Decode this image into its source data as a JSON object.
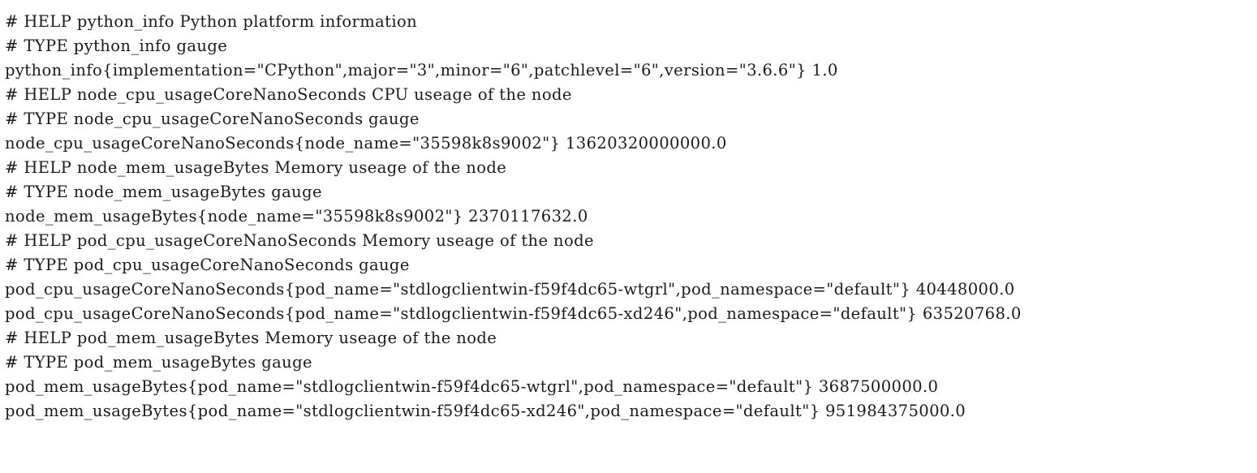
{
  "page": {
    "kind": "prometheus-metrics-plain-text",
    "content_type": "text/plain",
    "background_color": "#ffffff",
    "text_color": "#111111"
  },
  "metrics": {
    "lines": [
      {
        "id": "help-python-info",
        "kind": "comment",
        "text": "# HELP python_info Python platform information"
      },
      {
        "id": "type-python-info",
        "kind": "comment",
        "text": "# TYPE python_info gauge"
      },
      {
        "id": "sample-python-info",
        "kind": "sample",
        "text": "python_info{implementation=\"CPython\",major=\"3\",minor=\"6\",patchlevel=\"6\",version=\"3.6.6\"} 1.0"
      },
      {
        "id": "help-node-cpu",
        "kind": "comment",
        "text": "# HELP node_cpu_usageCoreNanoSeconds CPU useage of the node"
      },
      {
        "id": "type-node-cpu",
        "kind": "comment",
        "text": "# TYPE node_cpu_usageCoreNanoSeconds gauge"
      },
      {
        "id": "sample-node-cpu",
        "kind": "sample",
        "text": "node_cpu_usageCoreNanoSeconds{node_name=\"35598k8s9002\"} 13620320000000.0"
      },
      {
        "id": "help-node-mem",
        "kind": "comment",
        "text": "# HELP node_mem_usageBytes Memory useage of the node"
      },
      {
        "id": "type-node-mem",
        "kind": "comment",
        "text": "# TYPE node_mem_usageBytes gauge"
      },
      {
        "id": "sample-node-mem",
        "kind": "sample",
        "text": "node_mem_usageBytes{node_name=\"35598k8s9002\"} 2370117632.0"
      },
      {
        "id": "help-pod-cpu",
        "kind": "comment",
        "text": "# HELP pod_cpu_usageCoreNanoSeconds Memory useage of the node"
      },
      {
        "id": "type-pod-cpu",
        "kind": "comment",
        "text": "# TYPE pod_cpu_usageCoreNanoSeconds gauge"
      },
      {
        "id": "sample-pod-cpu-wtgrl",
        "kind": "sample",
        "text": "pod_cpu_usageCoreNanoSeconds{pod_name=\"stdlogclientwin-f59f4dc65-wtgrl\",pod_namespace=\"default\"} 40448000.0"
      },
      {
        "id": "sample-pod-cpu-xd246",
        "kind": "sample",
        "text": "pod_cpu_usageCoreNanoSeconds{pod_name=\"stdlogclientwin-f59f4dc65-xd246\",pod_namespace=\"default\"} 63520768.0"
      },
      {
        "id": "help-pod-mem",
        "kind": "comment",
        "text": "# HELP pod_mem_usageBytes Memory useage of the node"
      },
      {
        "id": "type-pod-mem",
        "kind": "comment",
        "text": "# TYPE pod_mem_usageBytes gauge"
      },
      {
        "id": "sample-pod-mem-wtgrl",
        "kind": "sample",
        "text": "pod_mem_usageBytes{pod_name=\"stdlogclientwin-f59f4dc65-wtgrl\",pod_namespace=\"default\"} 3687500000.0"
      },
      {
        "id": "sample-pod-mem-xd246",
        "kind": "sample",
        "text": "pod_mem_usageBytes{pod_name=\"stdlogclientwin-f59f4dc65-xd246\",pod_namespace=\"default\"} 951984375000.0"
      }
    ],
    "families": [
      {
        "name": "python_info",
        "help": "Python platform information",
        "type": "gauge",
        "samples": [
          {
            "labels": {
              "implementation": "CPython",
              "major": "3",
              "minor": "6",
              "patchlevel": "6",
              "version": "3.6.6"
            },
            "value": "1.0"
          }
        ]
      },
      {
        "name": "node_cpu_usageCoreNanoSeconds",
        "help": "CPU useage of the node",
        "type": "gauge",
        "samples": [
          {
            "labels": {
              "node_name": "35598k8s9002"
            },
            "value": "13620320000000.0"
          }
        ]
      },
      {
        "name": "node_mem_usageBytes",
        "help": "Memory useage of the node",
        "type": "gauge",
        "samples": [
          {
            "labels": {
              "node_name": "35598k8s9002"
            },
            "value": "2370117632.0"
          }
        ]
      },
      {
        "name": "pod_cpu_usageCoreNanoSeconds",
        "help": "Memory useage of the node",
        "type": "gauge",
        "samples": [
          {
            "labels": {
              "pod_name": "stdlogclientwin-f59f4dc65-wtgrl",
              "pod_namespace": "default"
            },
            "value": "40448000.0"
          },
          {
            "labels": {
              "pod_name": "stdlogclientwin-f59f4dc65-xd246",
              "pod_namespace": "default"
            },
            "value": "63520768.0"
          }
        ]
      },
      {
        "name": "pod_mem_usageBytes",
        "help": "Memory useage of the node",
        "type": "gauge",
        "samples": [
          {
            "labels": {
              "pod_name": "stdlogclientwin-f59f4dc65-wtgrl",
              "pod_namespace": "default"
            },
            "value": "3687500000.0"
          },
          {
            "labels": {
              "pod_name": "stdlogclientwin-f59f4dc65-xd246",
              "pod_namespace": "default"
            },
            "value": "951984375000.0"
          }
        ]
      }
    ]
  }
}
